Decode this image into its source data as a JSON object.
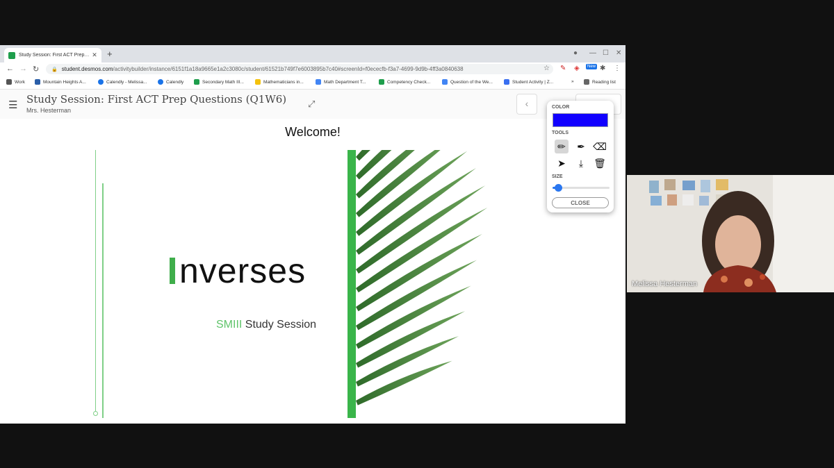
{
  "browser": {
    "tab_title": "Study Session: First ACT Prep Q...",
    "url_host": "student.desmos.com",
    "url_path": "/activitybuilder/instance/6151f1a18a9665e1a2c3080c/student/61521b749f7e6003895b7c40#screenId=f0ececfb-f3a7-4699-9d9b-4ff3a0840638",
    "bookmarks": [
      "Work",
      "Mountain Heights A...",
      "Calendly - Melissa...",
      "Calendly",
      "Secondary Math III...",
      "Mathematicians in...",
      "Math Department T...",
      "Competency Check...",
      "Question of the We...",
      "Student Activity | Z...",
      "»",
      "Reading list"
    ],
    "ext_new_badge": "New"
  },
  "app": {
    "title": "Study Session: First ACT Prep Questions (Q1W6)",
    "teacher": "Mrs. Hesterman"
  },
  "slide": {
    "welcome": "Welcome!",
    "main_word": "nverses",
    "sub_accent": "SMIII",
    "sub_text": " Study Session"
  },
  "draw_panel": {
    "color_label": "COLOR",
    "color_value": "#1100ff",
    "tools_label": "TOOLS",
    "tools": [
      "pencil-icon",
      "highlighter-icon",
      "eraser-icon",
      "pointer-icon",
      "download-icon",
      "trash-icon"
    ],
    "selected_tool": "pencil-icon",
    "size_label": "SIZE",
    "size_level": 0.1,
    "close_label": "CLOSE"
  },
  "video": {
    "participant_name": "Melissa Hesterman"
  }
}
